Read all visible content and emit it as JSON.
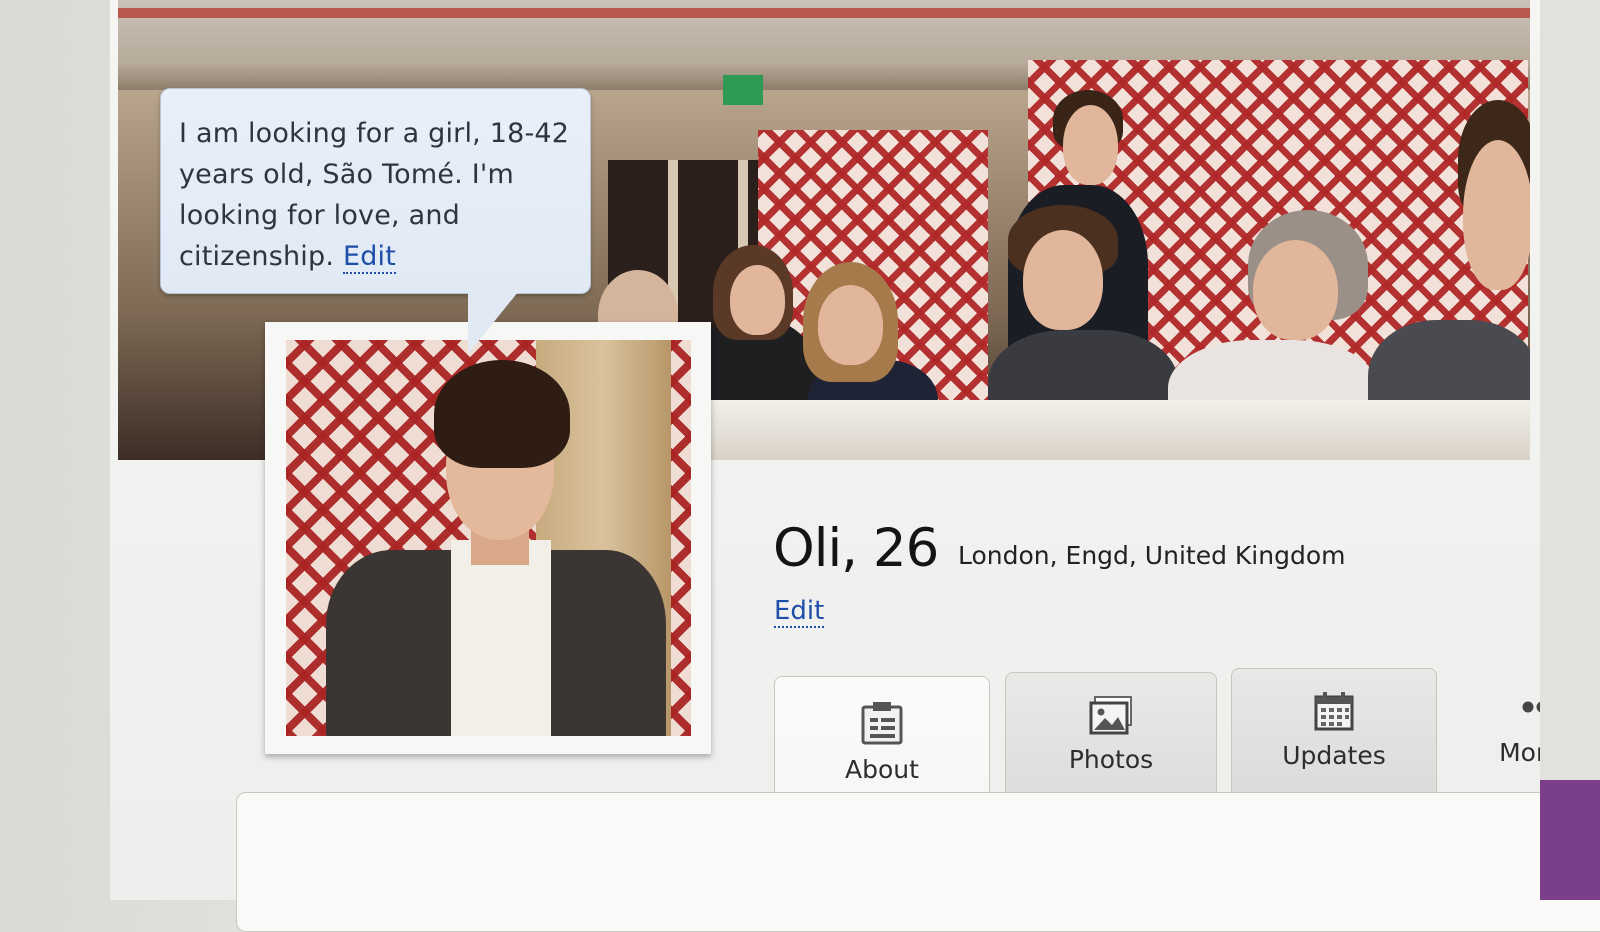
{
  "profile": {
    "status_message": "I am looking for a girl, 18-42 years old, São Tomé. I'm looking for love, and citizenship.",
    "status_edit_label": "Edit",
    "name_age": "Oli, 26",
    "location": "London, Engd, United Kingdom",
    "edit_label": "Edit"
  },
  "tabs": [
    {
      "label": "About",
      "icon": "clipboard-icon",
      "active": true
    },
    {
      "label": "Photos",
      "icon": "image-icon",
      "active": false
    },
    {
      "label": "Updates",
      "icon": "calendar-icon",
      "active": false
    },
    {
      "label": "More...",
      "icon": "more-dots-icon",
      "active": false
    }
  ],
  "colors": {
    "link": "#1d4ea8",
    "bubble_bg": "#e1e9f5",
    "curtain_red": "#b02828"
  }
}
